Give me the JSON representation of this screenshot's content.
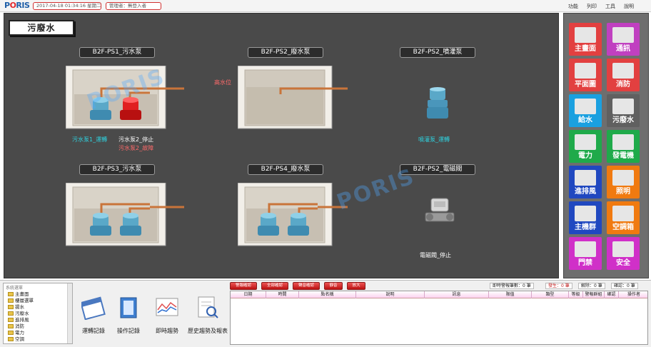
{
  "topbar": {
    "datetime": "2017-04-18 01:34:16 星期二",
    "user": "管理者：無登入者",
    "menu": [
      "功能",
      "列印",
      "工具",
      "說明"
    ]
  },
  "page": {
    "title": "污廢水"
  },
  "pumps": [
    {
      "label": "B2F-PS1_污水泵",
      "status": [
        "污水泵1_運轉",
        "污水泵2_停止",
        "污水泵2_故障"
      ]
    },
    {
      "label": "B2F-PS2_廢水泵",
      "high_level": "高水位"
    },
    {
      "label": "B2F-PS2_噴灌泵",
      "status": [
        "噴灌泵_運轉"
      ]
    },
    {
      "label": "B2F-PS3_污水泵"
    },
    {
      "label": "B2F-PS4_廢水泵"
    },
    {
      "label": "B2F-PS2_電磁閥",
      "status": [
        "電磁閥_停止"
      ]
    }
  ],
  "watermark": [
    "PORIS",
    "PORIS"
  ],
  "nav": [
    {
      "label": "主畫面",
      "color": "#e24040"
    },
    {
      "label": "通訊",
      "color": "#c040c0"
    },
    {
      "label": "平面圖",
      "color": "#e24040"
    },
    {
      "label": "消防",
      "color": "#e24040"
    },
    {
      "label": "給水",
      "color": "#1aa0e0"
    },
    {
      "label": "污廢水",
      "color": "#606060"
    },
    {
      "label": "電力",
      "color": "#1faa4a"
    },
    {
      "label": "發電機",
      "color": "#1faa4a"
    },
    {
      "label": "進排風",
      "color": "#2048c0"
    },
    {
      "label": "照明",
      "color": "#f07a10"
    },
    {
      "label": "主機群",
      "color": "#2048c0"
    },
    {
      "label": "空調箱",
      "color": "#f07a10"
    },
    {
      "label": "門禁",
      "color": "#d030c8"
    },
    {
      "label": "安全",
      "color": "#d030c8"
    }
  ],
  "tree": {
    "header": "系統選單",
    "items": [
      "主畫面",
      "樓層選單",
      "揚水",
      "污廢水",
      "進排風",
      "消防",
      "電力",
      "空調"
    ]
  },
  "tools": [
    "運轉記錄",
    "操作記錄",
    "即時趨勢",
    "歷史趨勢及報表"
  ],
  "alarm_buttons": [
    "警報確認",
    "全部確認",
    "聲音確認",
    "靜音",
    "放大"
  ],
  "alarm_info": {
    "count": "即時警報筆數：0 筆",
    "occur": "發生：0 筆",
    "clear": "解除：0 筆",
    "confirm": "確認：0 筆"
  },
  "grid_columns": [
    "日期",
    "時間",
    "點名稱",
    "說明",
    "訊息",
    "限值",
    "類型",
    "等級",
    "警報群組",
    "確認",
    "操作者"
  ]
}
